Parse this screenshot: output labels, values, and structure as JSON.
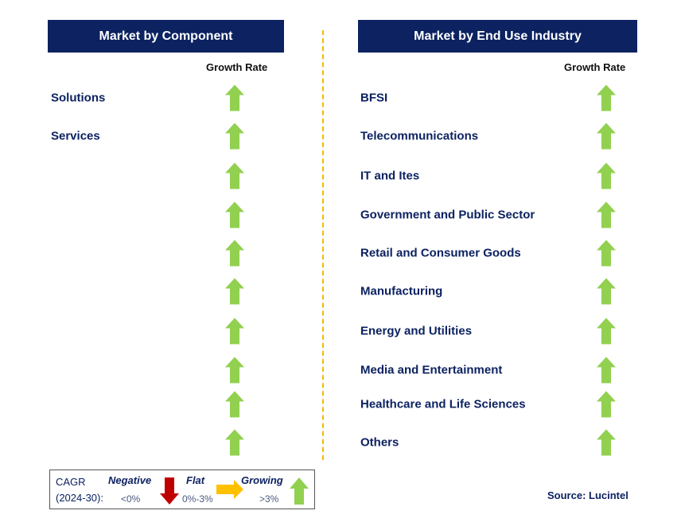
{
  "left": {
    "title": "Market by Component",
    "growth_header": "Growth Rate",
    "items": [
      "Solutions",
      "Services",
      "",
      "",
      "",
      "",
      "",
      "",
      "",
      ""
    ]
  },
  "right": {
    "title": "Market by End Use Industry",
    "growth_header": "Growth Rate",
    "items": [
      "BFSI",
      "Telecommunications",
      "IT and Ites",
      "Government and Public Sector",
      "Retail and Consumer Goods",
      "Manufacturing",
      "Energy and Utilities",
      "Media and Entertainment",
      "Healthcare and Life Sciences",
      "Others"
    ]
  },
  "legend": {
    "cagr": "CAGR",
    "period": "(2024-30):",
    "negative": "Negative",
    "negative_range": "<0%",
    "flat": "Flat",
    "flat_range": "0%-3%",
    "growing": "Growing",
    "growing_range": ">3%"
  },
  "source": "Source: Lucintel",
  "colors": {
    "header": "#0c2261",
    "growing": "#92d050",
    "negative": "#c00000",
    "flat": "#ffc000"
  }
}
